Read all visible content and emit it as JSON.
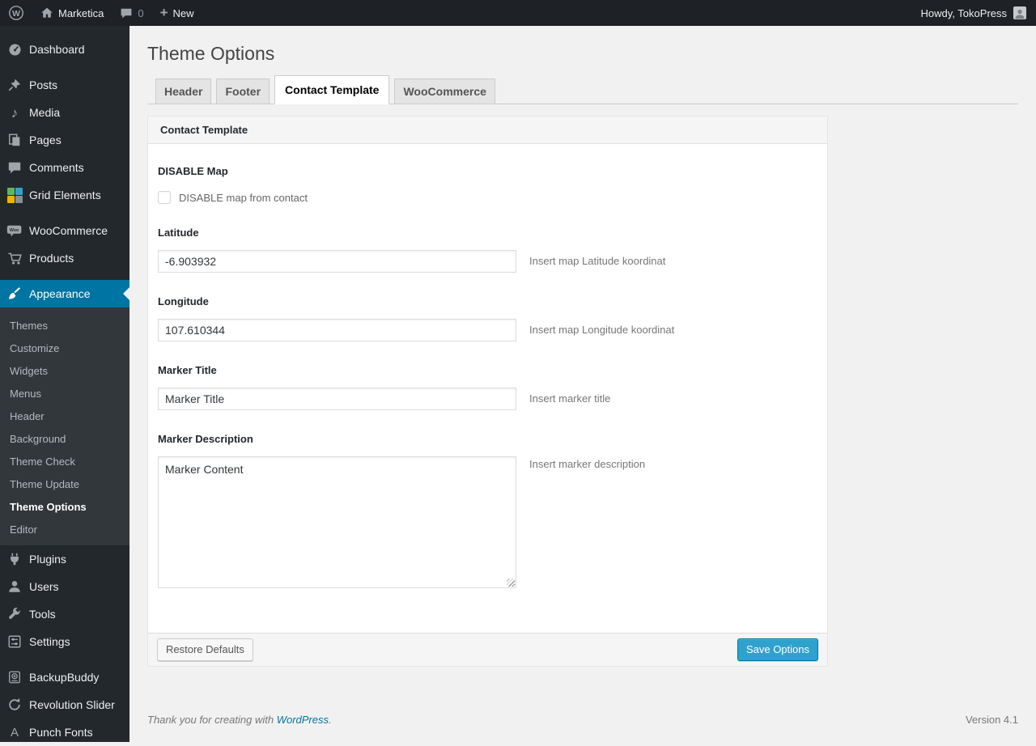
{
  "admin_bar": {
    "logo_letter": "W",
    "site_name": "Marketica",
    "comments_count": "0",
    "new_label": "New",
    "howdy": "Howdy, TokoPress"
  },
  "icons": {
    "plus-icon": "+",
    "media-icon": "♪",
    "punch-fonts-icon": "A"
  },
  "sidebar": {
    "items": [
      {
        "label": "Dashboard"
      },
      {
        "label": "Posts"
      },
      {
        "label": "Media"
      },
      {
        "label": "Pages"
      },
      {
        "label": "Comments"
      },
      {
        "label": "Grid Elements"
      },
      {
        "label": "WooCommerce"
      },
      {
        "label": "Products"
      },
      {
        "label": "Appearance"
      },
      {
        "label": "Plugins"
      },
      {
        "label": "Users"
      },
      {
        "label": "Tools"
      },
      {
        "label": "Settings"
      },
      {
        "label": "BackupBuddy"
      },
      {
        "label": "Revolution Slider"
      },
      {
        "label": "Punch Fonts"
      }
    ],
    "appearance_submenu": [
      "Themes",
      "Customize",
      "Widgets",
      "Menus",
      "Header",
      "Background",
      "Theme Check",
      "Theme Update",
      "Theme Options",
      "Editor"
    ],
    "current_submenu": "Theme Options"
  },
  "page": {
    "title": "Theme Options",
    "tabs": [
      {
        "label": "Header"
      },
      {
        "label": "Footer"
      },
      {
        "label": "Contact Template"
      },
      {
        "label": "WooCommerce"
      }
    ],
    "active_tab": "Contact Template"
  },
  "panel": {
    "title": "Contact Template",
    "disable_map": {
      "label": "DISABLE Map",
      "checkbox_label": "DISABLE map from contact",
      "checked": false
    },
    "latitude": {
      "label": "Latitude",
      "value": "-6.903932",
      "help": "Insert map Latitude koordinat"
    },
    "longitude": {
      "label": "Longitude",
      "value": "107.610344",
      "help": "Insert map Longitude koordinat"
    },
    "marker_title": {
      "label": "Marker Title",
      "value": "Marker Title",
      "help": "Insert marker title"
    },
    "marker_description": {
      "label": "Marker Description",
      "value": "Marker Content",
      "help": "Insert marker description"
    },
    "buttons": {
      "restore": "Restore Defaults",
      "save": "Save Options"
    }
  },
  "page_footer": {
    "thanks_text": "Thank you for creating with ",
    "link_label": "WordPress",
    "period": ".",
    "version": "Version 4.1"
  },
  "colors": {
    "menu_highlight": "#0074a2",
    "primary_button": "#2ea2cc",
    "link": "#0074a2",
    "admin_bar_bg": "#1e2227",
    "sidebar_bg": "#23282d",
    "submenu_bg": "#32373c"
  }
}
